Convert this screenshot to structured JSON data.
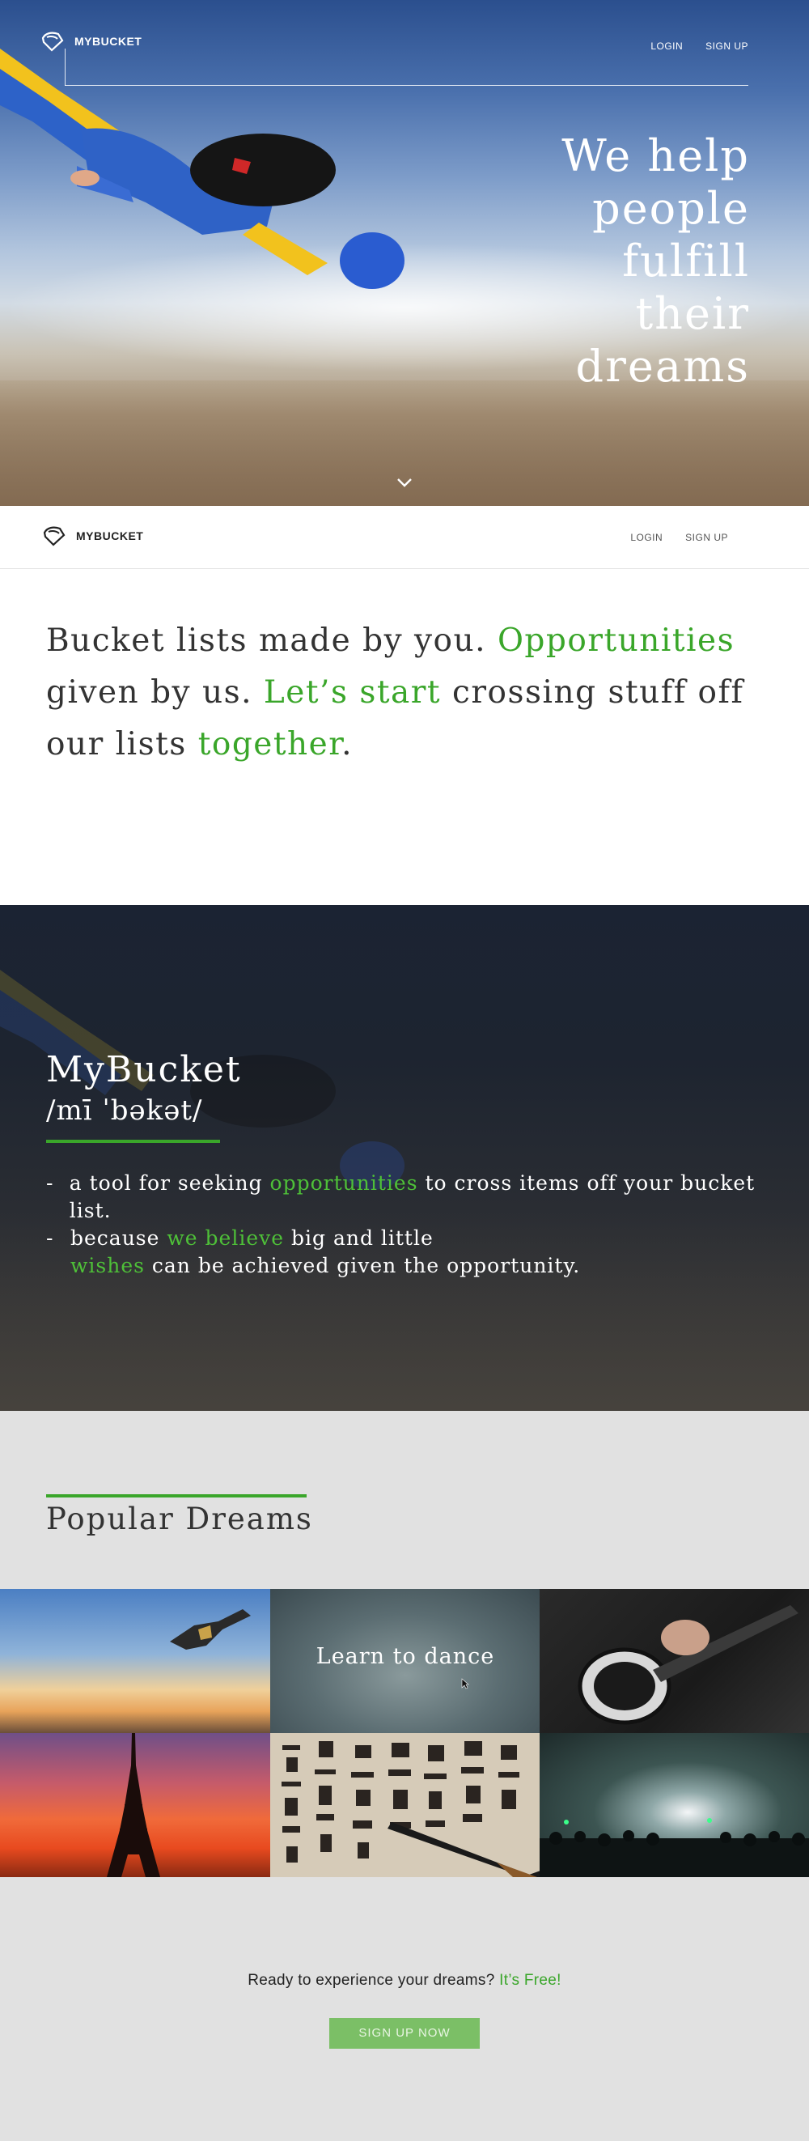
{
  "brand": {
    "name": "MYBUCKET"
  },
  "nav": {
    "login": "LOGIN",
    "signup": "SIGN UP"
  },
  "hero": {
    "headline_lines": [
      "We help",
      "people",
      "fulfill",
      "their",
      "dreams"
    ]
  },
  "intro": {
    "p1": "Bucket lists made by you. ",
    "g1": "Opportunities",
    "p2": " given by us. ",
    "g2": "Let’s start",
    "p3": " crossing stuff off our lists ",
    "g3": "together",
    "p4": "."
  },
  "definition": {
    "title": "MyBucket",
    "phonetic": "/mī ˈbəkət/",
    "item1": {
      "dash": "-",
      "a": "a tool for seeking ",
      "g": "opportunities",
      "b": " to cross items off your bucket list."
    },
    "item2": {
      "dash": "-",
      "a": "because ",
      "g1": "we believe",
      "b": " big and little ",
      "g2": "wishes",
      "c": " can be achieved given the opportunity."
    }
  },
  "popular": {
    "title": "Popular Dreams",
    "tiles": [
      {
        "icon": "skydiver-image"
      },
      {
        "label": "Learn to dance"
      },
      {
        "icon": "guitar-image"
      },
      {
        "icon": "eiffel-tower-image"
      },
      {
        "icon": "calligraphy-image"
      },
      {
        "icon": "concert-image"
      }
    ]
  },
  "cta": {
    "text": "Ready to experience your dreams? ",
    "highlight": "It’s Free!",
    "button": "SIGN UP NOW"
  },
  "colors": {
    "accent": "#3aa62a",
    "button": "#7bbf66",
    "footer_bg": "#e1e1e1"
  }
}
